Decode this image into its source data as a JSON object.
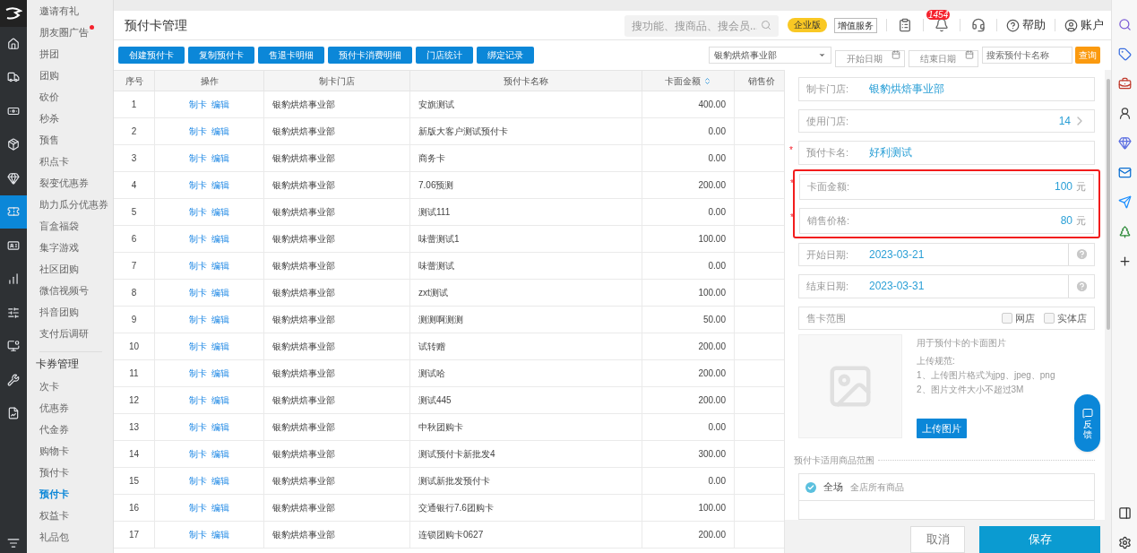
{
  "nav_rail": {
    "items": [
      {
        "kind": "home",
        "selected": false
      },
      {
        "kind": "truck",
        "selected": false
      },
      {
        "kind": "money",
        "selected": false
      },
      {
        "kind": "box",
        "selected": false
      },
      {
        "kind": "diamond",
        "selected": false
      },
      {
        "kind": "ticket",
        "selected": true
      },
      {
        "kind": "card",
        "selected": false
      },
      {
        "kind": "chart",
        "selected": false
      },
      {
        "kind": "sliders",
        "selected": false
      },
      {
        "kind": "screen",
        "selected": false
      },
      {
        "kind": "tools",
        "selected": false
      },
      {
        "kind": "report",
        "selected": false
      }
    ]
  },
  "submenu": {
    "items": [
      {
        "label": "邀请有礼",
        "selected": false,
        "dot": false
      },
      {
        "label": "朋友圈广告",
        "selected": false,
        "dot": true
      },
      {
        "label": "拼团",
        "selected": false,
        "dot": false
      },
      {
        "label": "团购",
        "selected": false,
        "dot": false
      },
      {
        "label": "砍价",
        "selected": false,
        "dot": false
      },
      {
        "label": "秒杀",
        "selected": false,
        "dot": false
      },
      {
        "label": "预售",
        "selected": false,
        "dot": false
      },
      {
        "label": "积点卡",
        "selected": false,
        "dot": false
      },
      {
        "label": "裂变优惠券",
        "selected": false,
        "dot": false
      },
      {
        "label": "助力瓜分优惠券",
        "selected": false,
        "dot": false
      },
      {
        "label": "盲盒福袋",
        "selected": false,
        "dot": false
      },
      {
        "label": "集字游戏",
        "selected": false,
        "dot": false
      },
      {
        "label": "社区团购",
        "selected": false,
        "dot": false
      },
      {
        "label": "微信视频号",
        "selected": false,
        "dot": false
      },
      {
        "label": "抖音团购",
        "selected": false,
        "dot": false
      },
      {
        "label": "支付后调研",
        "selected": false,
        "dot": false
      }
    ],
    "group_title": "卡券管理",
    "group_items": [
      {
        "label": "次卡",
        "selected": false
      },
      {
        "label": "优惠券",
        "selected": false
      },
      {
        "label": "代金券",
        "selected": false
      },
      {
        "label": "购物卡",
        "selected": false
      },
      {
        "label": "预付卡",
        "selected": false
      },
      {
        "label": "预付卡",
        "selected": true
      },
      {
        "label": "权益卡",
        "selected": false
      },
      {
        "label": "礼品包",
        "selected": false
      }
    ]
  },
  "header": {
    "title": "预付卡管理",
    "search": {
      "placeholder": "搜功能、搜商品、搜会员..."
    },
    "edition": "企业版",
    "value_added": "增值服务",
    "notification_count": "1454",
    "help": "帮助",
    "account": "账户"
  },
  "toolbar": {
    "buttons": [
      "创建预付卡",
      "复制预付卡",
      "售退卡明细",
      "预付卡消费明细",
      "门店统计",
      "绑定记录"
    ],
    "store_select": "银豹烘焙事业部",
    "start_date": {
      "placeholder": "开始日期"
    },
    "end_date": {
      "placeholder": "结束日期"
    },
    "name_search": {
      "placeholder": "搜索预付卡名称"
    },
    "query": "查询"
  },
  "table": {
    "columns": [
      "序号",
      "操作",
      "制卡门店",
      "预付卡名称",
      "卡面金额",
      "销售价"
    ],
    "rows": [
      {
        "no": "1",
        "actions": [
          "制卡",
          "编辑"
        ],
        "store": "银豹烘焙事业部",
        "name": "安旗测试",
        "amount": "400.00"
      },
      {
        "no": "2",
        "actions": [
          "制卡",
          "编辑"
        ],
        "store": "银豹烘焙事业部",
        "name": "新版大客户测试预付卡",
        "amount": "0.00"
      },
      {
        "no": "3",
        "actions": [
          "制卡",
          "编辑"
        ],
        "store": "银豹烘焙事业部",
        "name": "商务卡",
        "amount": "0.00"
      },
      {
        "no": "4",
        "actions": [
          "制卡",
          "编辑"
        ],
        "store": "银豹烘焙事业部",
        "name": "7.06预测",
        "amount": "200.00"
      },
      {
        "no": "5",
        "actions": [
          "制卡",
          "编辑"
        ],
        "store": "银豹烘焙事业部",
        "name": "测试111",
        "amount": "0.00"
      },
      {
        "no": "6",
        "actions": [
          "制卡",
          "编辑"
        ],
        "store": "银豹烘焙事业部",
        "name": "味蕾测试1",
        "amount": "100.00"
      },
      {
        "no": "7",
        "actions": [
          "制卡",
          "编辑"
        ],
        "store": "银豹烘焙事业部",
        "name": "味蕾测试",
        "amount": "0.00"
      },
      {
        "no": "8",
        "actions": [
          "制卡",
          "编辑"
        ],
        "store": "银豹烘焙事业部",
        "name": "zxt测试",
        "amount": "100.00"
      },
      {
        "no": "9",
        "actions": [
          "制卡",
          "编辑"
        ],
        "store": "银豹烘焙事业部",
        "name": "测测啊测测",
        "amount": "50.00"
      },
      {
        "no": "10",
        "actions": [
          "制卡",
          "编辑"
        ],
        "store": "银豹烘焙事业部",
        "name": "试转赠",
        "amount": "200.00"
      },
      {
        "no": "11",
        "actions": [
          "制卡",
          "编辑"
        ],
        "store": "银豹烘焙事业部",
        "name": "测试哈",
        "amount": "200.00"
      },
      {
        "no": "12",
        "actions": [
          "制卡",
          "编辑"
        ],
        "store": "银豹烘焙事业部",
        "name": "测试445",
        "amount": "200.00"
      },
      {
        "no": "13",
        "actions": [
          "制卡",
          "编辑"
        ],
        "store": "银豹烘焙事业部",
        "name": "中秋团购卡",
        "amount": "0.00"
      },
      {
        "no": "14",
        "actions": [
          "制卡",
          "编辑"
        ],
        "store": "银豹烘焙事业部",
        "name": "测试预付卡新批发4",
        "amount": "300.00"
      },
      {
        "no": "15",
        "actions": [
          "制卡",
          "编辑"
        ],
        "store": "银豹烘焙事业部",
        "name": "测试新批发预付卡",
        "amount": "0.00"
      },
      {
        "no": "16",
        "actions": [
          "制卡",
          "编辑"
        ],
        "store": "银豹烘焙事业部",
        "name": "交通银行7.6团购卡",
        "amount": "100.00"
      },
      {
        "no": "17",
        "actions": [
          "制卡",
          "编辑"
        ],
        "store": "银豹烘焙事业部",
        "name": "连锁团购卡0627",
        "amount": "200.00"
      }
    ]
  },
  "form": {
    "required_mark": "*",
    "fields": [
      {
        "kind": "text",
        "label": "制卡门店:",
        "value": "银豹烘焙事业部",
        "required": false,
        "highlighted": false
      },
      {
        "kind": "link",
        "label": "使用门店:",
        "value": "14",
        "required": false,
        "highlighted": false
      },
      {
        "kind": "text",
        "label": "预付卡名:",
        "value": "好利测试",
        "required": true,
        "highlighted": false
      },
      {
        "kind": "amount",
        "label": "卡面金额:",
        "value": "100",
        "unit": "元",
        "required": true,
        "highlighted": true
      },
      {
        "kind": "amount",
        "label": "销售价格:",
        "value": "80",
        "unit": "元",
        "required": true,
        "highlighted": true
      },
      {
        "kind": "date",
        "label": "开始日期:",
        "value": "2023-03-21",
        "required": false,
        "highlighted": false
      },
      {
        "kind": "date",
        "label": "结束日期:",
        "value": "2023-03-31",
        "required": false,
        "highlighted": false
      },
      {
        "kind": "checks",
        "label": "售卡范围",
        "options": [
          {
            "label": "网店",
            "checked": false
          },
          {
            "label": "实体店",
            "checked": false
          }
        ],
        "required": false,
        "highlighted": false
      }
    ],
    "upload": {
      "hint": "用于预付卡的卡面图片",
      "rules_title": "上传规范:",
      "rules": [
        "1、上传图片格式为jpg、jpeg、png",
        "2、图片文件大小不超过3M"
      ],
      "button": "上传图片"
    },
    "scope": {
      "title": "预付卡适用商品范围",
      "options": [
        {
          "label": "全场",
          "desc": "全店所有商品",
          "selected": true
        }
      ]
    },
    "cancel": "取消",
    "save": "保存"
  },
  "feedback": "反馈"
}
